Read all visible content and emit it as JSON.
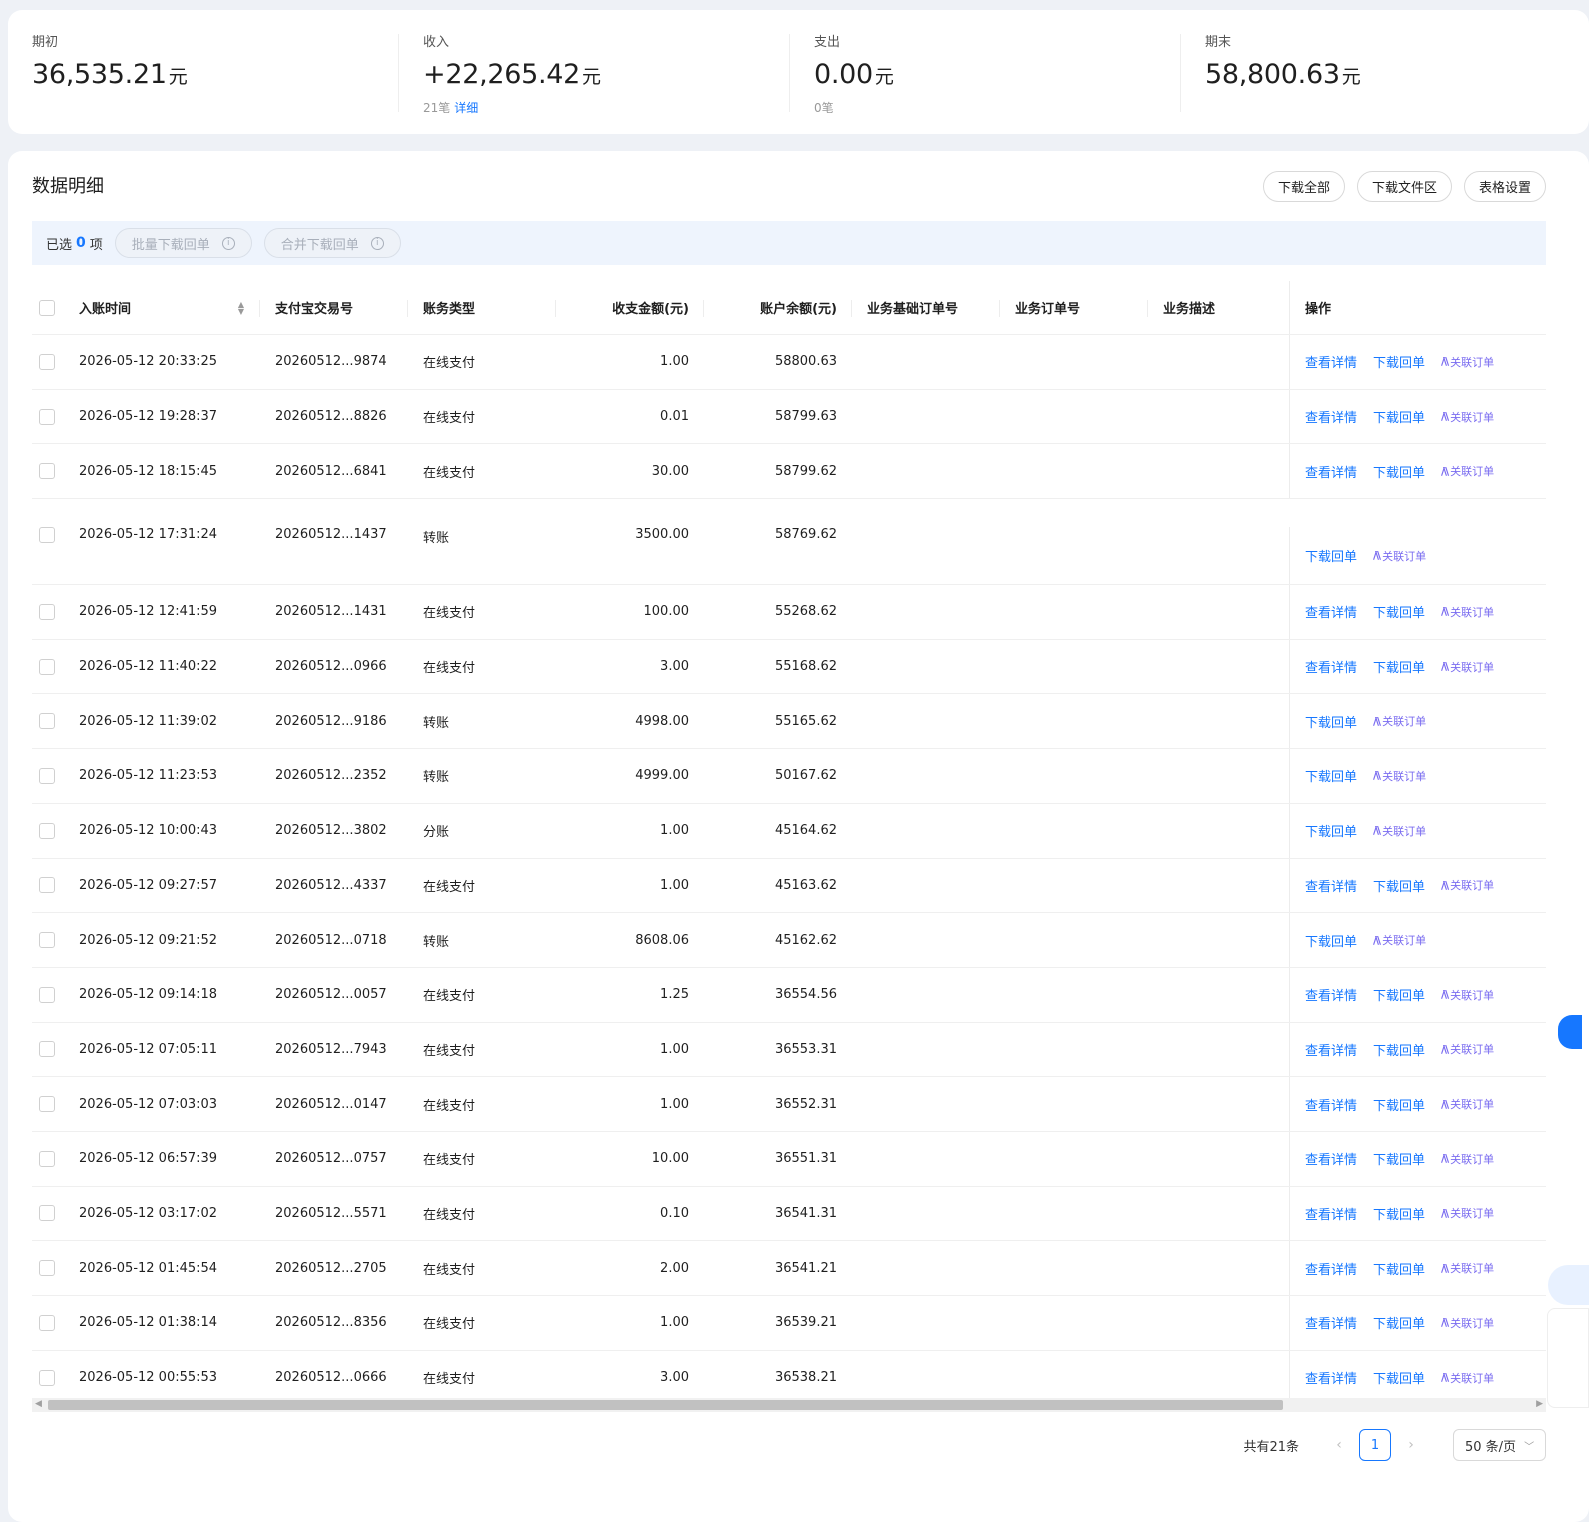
{
  "summary": [
    {
      "label": "期初",
      "value": "36,535.21",
      "unit": "元",
      "sub_count": "",
      "sub_link": ""
    },
    {
      "label": "收入",
      "value": "+22,265.42",
      "unit": "元",
      "sub_count": "21笔",
      "sub_link": "详细"
    },
    {
      "label": "支出",
      "value": "0.00",
      "unit": "元",
      "sub_count": "0笔",
      "sub_link": ""
    },
    {
      "label": "期末",
      "value": "58,800.63",
      "unit": "元",
      "sub_count": "",
      "sub_link": ""
    }
  ],
  "main": {
    "title": "数据明细",
    "buttons": {
      "download_all": "下载全部",
      "download_files": "下载文件区",
      "table_settings": "表格设置"
    },
    "selection": {
      "prefix": "已选",
      "count": "0",
      "suffix": "项",
      "batch_download": "批量下载回单",
      "merge_download": "合并下载回单"
    }
  },
  "table": {
    "headers": {
      "time": "入账时间",
      "trade_no": "支付宝交易号",
      "type": "账务类型",
      "amount": "收支金额(元)",
      "balance": "账户余额(元)",
      "base_order": "业务基础订单号",
      "order": "业务订单号",
      "desc": "业务描述",
      "ops": "操作"
    },
    "op_labels": {
      "detail": "查看详情",
      "download": "下载回单",
      "link_order": "关联订单"
    },
    "rows": [
      {
        "time": "2026-05-12 20:33:25",
        "no": "20260512...9874",
        "type": "在线支付",
        "amount": "1.00",
        "balance": "58800.63",
        "detail": true
      },
      {
        "time": "2026-05-12 19:28:37",
        "no": "20260512...8826",
        "type": "在线支付",
        "amount": "0.01",
        "balance": "58799.63",
        "detail": true
      },
      {
        "time": "2026-05-12 18:15:45",
        "no": "20260512...6841",
        "type": "在线支付",
        "amount": "30.00",
        "balance": "58799.62",
        "detail": true
      },
      {
        "time": "2026-05-12 17:31:24",
        "no": "20260512...1437",
        "type": "转账",
        "amount": "3500.00",
        "balance": "58769.62",
        "detail": false
      },
      {
        "time": "2026-05-12 12:41:59",
        "no": "20260512...1431",
        "type": "在线支付",
        "amount": "100.00",
        "balance": "55268.62",
        "detail": true
      },
      {
        "time": "2026-05-12 11:40:22",
        "no": "20260512...0966",
        "type": "在线支付",
        "amount": "3.00",
        "balance": "55168.62",
        "detail": true
      },
      {
        "time": "2026-05-12 11:39:02",
        "no": "20260512...9186",
        "type": "转账",
        "amount": "4998.00",
        "balance": "55165.62",
        "detail": false
      },
      {
        "time": "2026-05-12 11:23:53",
        "no": "20260512...2352",
        "type": "转账",
        "amount": "4999.00",
        "balance": "50167.62",
        "detail": false
      },
      {
        "time": "2026-05-12 10:00:43",
        "no": "20260512...3802",
        "type": "分账",
        "amount": "1.00",
        "balance": "45164.62",
        "detail": false
      },
      {
        "time": "2026-05-12 09:27:57",
        "no": "20260512...4337",
        "type": "在线支付",
        "amount": "1.00",
        "balance": "45163.62",
        "detail": true
      },
      {
        "time": "2026-05-12 09:21:52",
        "no": "20260512...0718",
        "type": "转账",
        "amount": "8608.06",
        "balance": "45162.62",
        "detail": false
      },
      {
        "time": "2026-05-12 09:14:18",
        "no": "20260512...0057",
        "type": "在线支付",
        "amount": "1.25",
        "balance": "36554.56",
        "detail": true
      },
      {
        "time": "2026-05-12 07:05:11",
        "no": "20260512...7943",
        "type": "在线支付",
        "amount": "1.00",
        "balance": "36553.31",
        "detail": true
      },
      {
        "time": "2026-05-12 07:03:03",
        "no": "20260512...0147",
        "type": "在线支付",
        "amount": "1.00",
        "balance": "36552.31",
        "detail": true
      },
      {
        "time": "2026-05-12 06:57:39",
        "no": "20260512...0757",
        "type": "在线支付",
        "amount": "10.00",
        "balance": "36551.31",
        "detail": true
      },
      {
        "time": "2026-05-12 03:17:02",
        "no": "20260512...5571",
        "type": "在线支付",
        "amount": "0.10",
        "balance": "36541.31",
        "detail": true
      },
      {
        "time": "2026-05-12 01:45:54",
        "no": "20260512...2705",
        "type": "在线支付",
        "amount": "2.00",
        "balance": "36541.21",
        "detail": true
      },
      {
        "time": "2026-05-12 01:38:14",
        "no": "20260512...8356",
        "type": "在线支付",
        "amount": "1.00",
        "balance": "36539.21",
        "detail": true
      },
      {
        "time": "2026-05-12 00:55:53",
        "no": "20260512...0666",
        "type": "在线支付",
        "amount": "3.00",
        "balance": "36538.21",
        "detail": true
      }
    ]
  },
  "pagination": {
    "total": "共有21条",
    "current": "1",
    "page_size": "50 条/页"
  },
  "colors": {
    "accent": "#1677ff",
    "ai": "#7a6cf0"
  }
}
